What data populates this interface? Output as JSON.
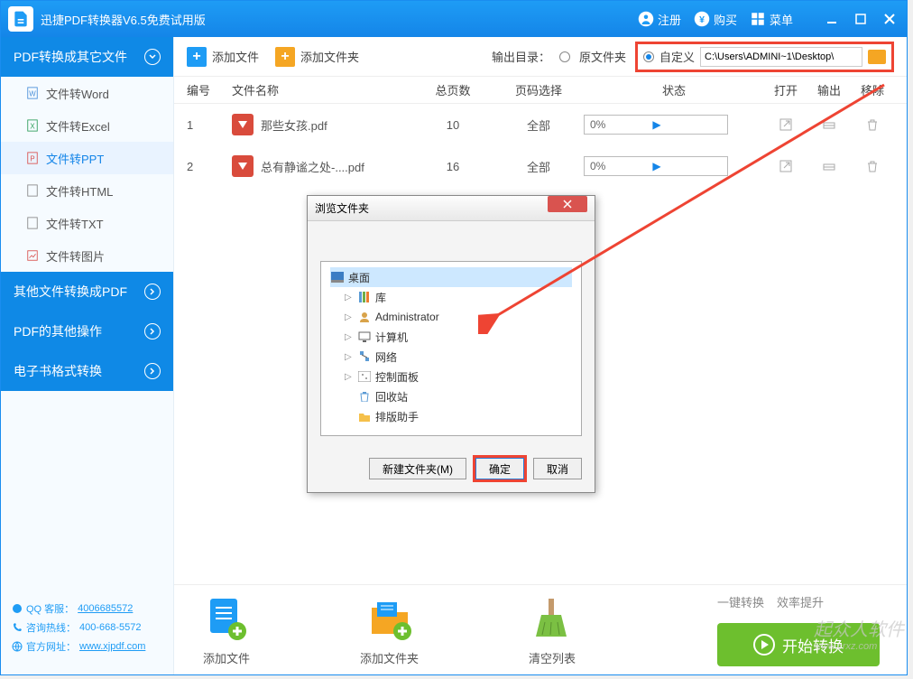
{
  "title": "迅捷PDF转换器V6.5免费试用版",
  "titlebar": {
    "register": "注册",
    "buy": "购买",
    "menu": "菜单"
  },
  "sidebar": {
    "headers": [
      "PDF转换成其它文件",
      "其他文件转换成PDF",
      "PDF的其他操作",
      "电子书格式转换"
    ],
    "items": [
      "文件转Word",
      "文件转Excel",
      "文件转PPT",
      "文件转HTML",
      "文件转TXT",
      "文件转图片"
    ],
    "footer": {
      "qq_label": "QQ 客服：",
      "qq": "4006685572",
      "hotline_label": "咨询热线：",
      "hotline": "400-668-5572",
      "site_label": "官方网址：",
      "site": "www.xjpdf.com"
    }
  },
  "toolbar": {
    "add_file": "添加文件",
    "add_folder": "添加文件夹",
    "output_label": "输出目录：",
    "radio_original": "原文件夹",
    "radio_custom": "自定义",
    "path": "C:\\Users\\ADMINI~1\\Desktop\\"
  },
  "columns": {
    "idx": "编号",
    "name": "文件名称",
    "pages": "总页数",
    "sel": "页码选择",
    "status": "状态",
    "open": "打开",
    "out": "输出",
    "del": "移除"
  },
  "rows": [
    {
      "idx": "1",
      "name": "那些女孩.pdf",
      "pages": "10",
      "sel": "全部",
      "pct": "0%"
    },
    {
      "idx": "2",
      "name": "总有静谧之处-....pdf",
      "pages": "16",
      "sel": "全部",
      "pct": "0%"
    }
  ],
  "bottom": {
    "add_file": "添加文件",
    "add_folder": "添加文件夹",
    "clear": "清空列表",
    "hint1": "一键转换",
    "hint2": "效率提升",
    "start": "开始转换"
  },
  "dialog": {
    "title": "浏览文件夹",
    "tree": [
      "桌面",
      "库",
      "Administrator",
      "计算机",
      "网络",
      "控制面板",
      "回收站",
      "排版助手"
    ],
    "new_folder": "新建文件夹(M)",
    "ok": "确定",
    "cancel": "取消"
  },
  "watermark": {
    "main": "起众人软件",
    "sub": "www.crxz.com"
  }
}
